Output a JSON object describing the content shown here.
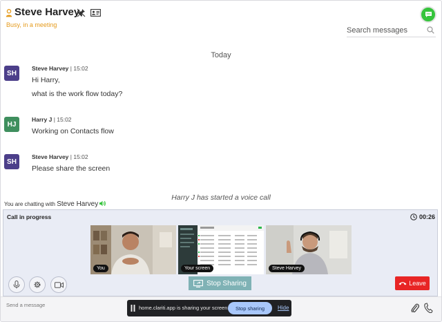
{
  "header": {
    "contact_name": "Steve Harvey",
    "status": "Busy, in a meeting",
    "search_placeholder": "Search messages"
  },
  "day_separator": "Today",
  "messages": [
    {
      "initials": "SH",
      "sender": "Steve Harvey",
      "time": "15:02",
      "lines": [
        "Hi Harry,",
        "what is the work flow today?"
      ],
      "avatar_color": "#4c3f8a"
    },
    {
      "initials": "HJ",
      "sender": "Harry J",
      "time": "15:02",
      "lines": [
        "Working on Contacts flow"
      ],
      "avatar_color": "#3f8f5e"
    },
    {
      "initials": "SH",
      "sender": "Steve Harvey",
      "time": "15:02",
      "lines": [
        "Please share the screen"
      ],
      "avatar_color": "#4c3f8a"
    }
  ],
  "system_note": "Harry J has started a voice call",
  "chatting_with": {
    "prefix": "You are chatting with",
    "name": "Steve Harvey"
  },
  "call": {
    "title": "Call in progress",
    "timer": "00:26",
    "tiles": [
      {
        "label": "You"
      },
      {
        "label": "Your screen"
      },
      {
        "label": "Steve Harvey"
      }
    ],
    "stop_sharing_label": "Stop Sharing",
    "leave_label": "Leave"
  },
  "composer": {
    "placeholder": "Send a message"
  },
  "share_bar": {
    "text": "home.clariti.app is sharing your screen.",
    "stop_label": "Stop sharing",
    "hide_label": "Hide"
  },
  "colors": {
    "status": "#e59a1b",
    "online_green": "#36c43c",
    "stop_sharing": "#7fb2b5",
    "leave": "#e82525"
  }
}
